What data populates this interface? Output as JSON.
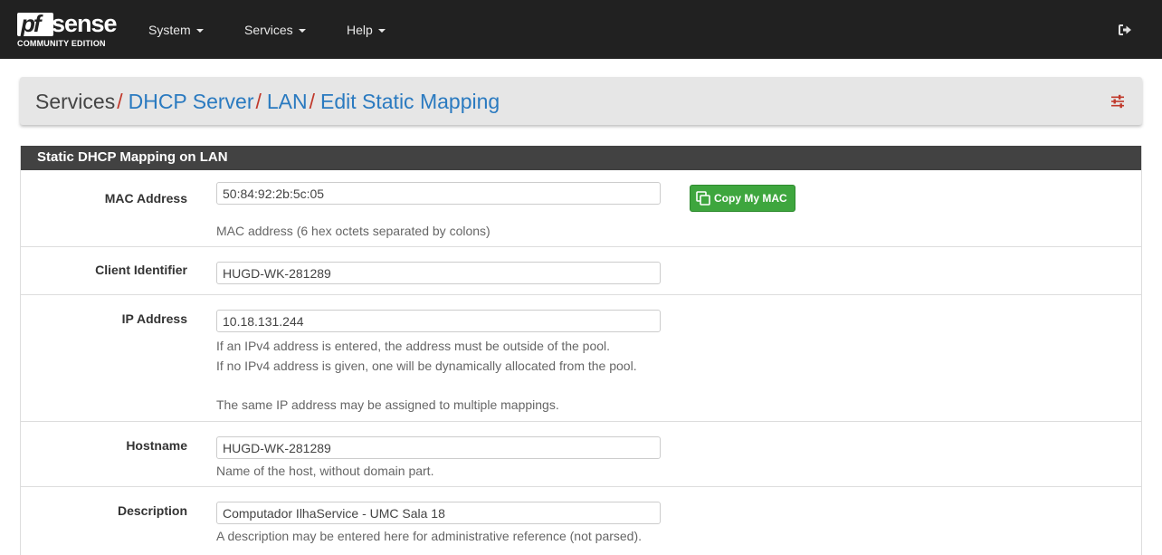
{
  "navbar": {
    "logo_pf": "pf",
    "logo_sense": "sense",
    "logo_edition": "COMMUNITY EDITION",
    "menus": [
      "System",
      "Services",
      "Help"
    ]
  },
  "breadcrumb": {
    "static": "Services",
    "links": [
      "DHCP Server",
      "LAN",
      "Edit Static Mapping"
    ],
    "separator": "/"
  },
  "panel": {
    "heading": "Static DHCP Mapping on LAN"
  },
  "form": {
    "mac": {
      "label": "MAC Address",
      "value": "50:84:92:2b:5c:05",
      "help": "MAC address (6 hex octets separated by colons)",
      "button": "Copy My MAC"
    },
    "client_id": {
      "label": "Client Identifier",
      "value": "HUGD-WK-281289"
    },
    "ip": {
      "label": "IP Address",
      "value": "10.18.131.244",
      "help_1": "If an IPv4 address is entered, the address must be outside of the pool.",
      "help_2": "If no IPv4 address is given, one will be dynamically allocated from the pool.",
      "help_3": "The same IP address may be assigned to multiple mappings."
    },
    "hostname": {
      "label": "Hostname",
      "value": "HUGD-WK-281289",
      "help": "Name of the host, without domain part."
    },
    "description": {
      "label": "Description",
      "value": "Computador IlhaService - UMC Sala 18",
      "help": "A description may be entered here for administrative reference (not parsed)."
    }
  },
  "colors": {
    "navbar_bg": "#212121",
    "crumb_separator": "#c0392b",
    "crumb_link": "#2a7ac0",
    "panel_heading_bg": "#424242",
    "button_success": "#3ea63e"
  },
  "icons": {
    "logout": "sign-out-icon",
    "settings": "sliders-icon",
    "copy": "clone-icon"
  }
}
